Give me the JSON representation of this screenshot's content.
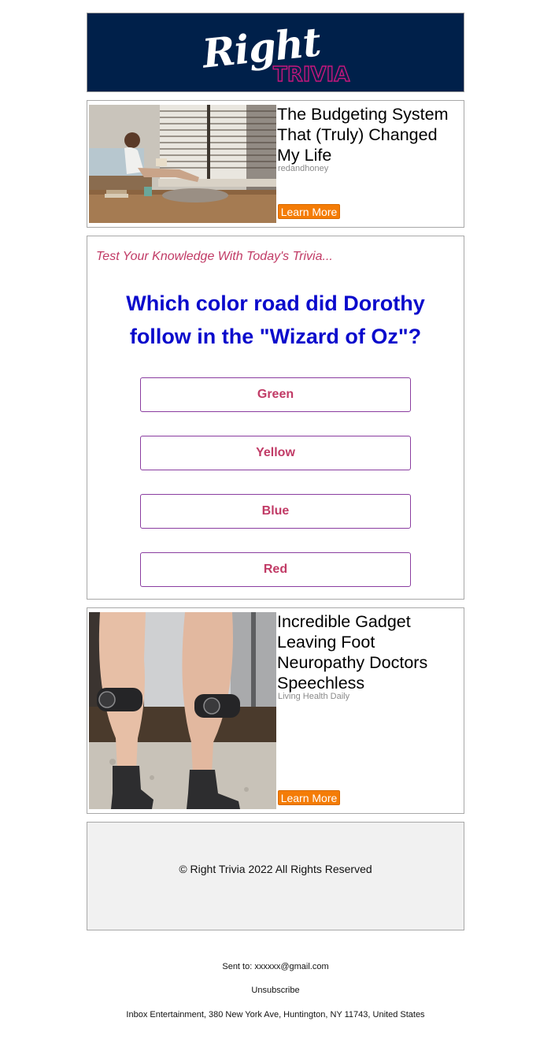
{
  "header": {
    "logo_word1": "Right",
    "logo_word2": "TRIVIA"
  },
  "ad1": {
    "title": "The Budgeting System That (Truly) Changed My Life",
    "source": "redandhoney",
    "button_label": "Learn More",
    "image": "woman-reading-by-window-photo"
  },
  "trivia": {
    "intro": "Test Your Knowledge With Today's Trivia...",
    "question": "Which color road did Dorothy follow in the \"Wizard of Oz\"?",
    "answers": [
      "Green",
      "Yellow",
      "Blue",
      "Red"
    ]
  },
  "ad2": {
    "title": "Incredible Gadget Leaving Foot Neuropathy Doctors Speechless",
    "source": "Living Health Daily",
    "button_label": "Learn More",
    "image": "legs-with-tens-pads-photo"
  },
  "footer": {
    "copyright": "© Right Trivia 2022 All Rights Reserved"
  },
  "bottom": {
    "sent_to": "Sent to: xxxxxx@gmail.com",
    "unsubscribe": "Unsubscribe",
    "address": "Inbox Entertainment, 380 New York Ave, Huntington, NY 11743, United States"
  },
  "colors": {
    "header_bg": "#00204a",
    "logo_accent": "#c8177e",
    "button_orange": "#f47c06",
    "question_blue": "#0a0acc",
    "answer_pink": "#c13b66",
    "answer_border": "#8a3da0",
    "footer_bg": "#f1f1f1"
  }
}
